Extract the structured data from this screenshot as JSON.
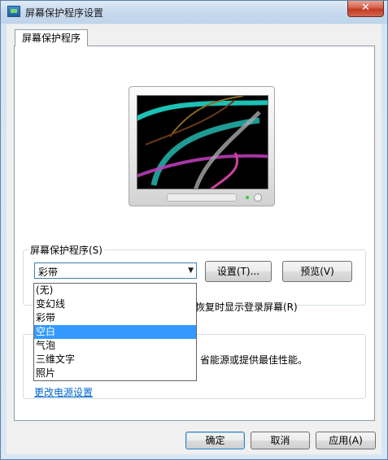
{
  "window": {
    "title": "屏幕保护程序设置",
    "close_symbol": "✕"
  },
  "tab": {
    "label": "屏幕保护程序"
  },
  "screensaver": {
    "group_label": "屏幕保护程序(S)",
    "selected": "彩带",
    "options": [
      "(无)",
      "变幻线",
      "彩带",
      "空白",
      "气泡",
      "三维文字",
      "照片"
    ],
    "highlighted_index": 3,
    "settings_button": "设置(T)...",
    "preview_button": "预览(V)",
    "resume_text": "恢复时显示登录屏幕(R)"
  },
  "power": {
    "text": "省能源或提供最佳性能。",
    "link": "更改电源设置"
  },
  "footer": {
    "ok": "确定",
    "cancel": "取消",
    "apply": "应用(A)"
  }
}
